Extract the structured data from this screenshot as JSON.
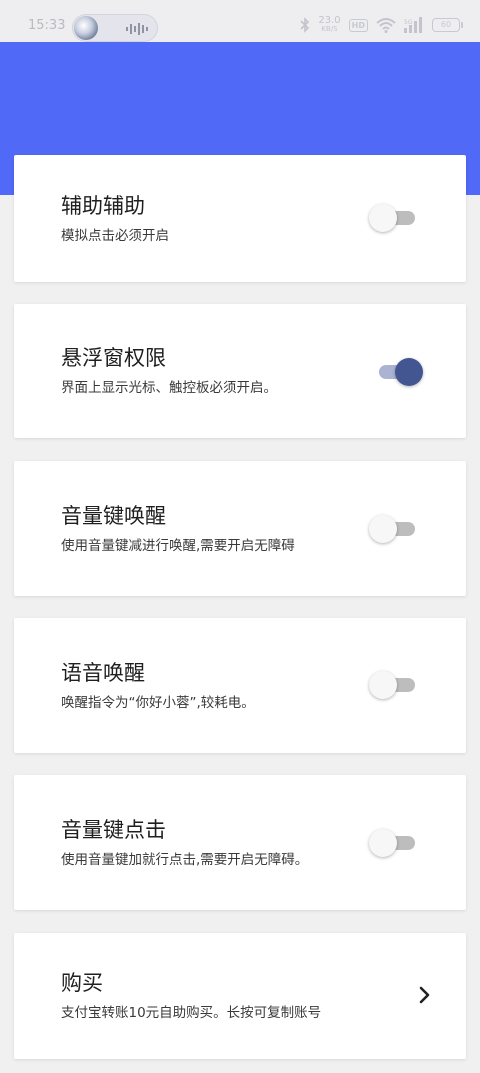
{
  "status_bar": {
    "time": "15:33",
    "net_speed": "23.0",
    "net_unit": "KB/S",
    "hd": "HD",
    "signal": "5G",
    "battery": "60"
  },
  "colors": {
    "header": "#5169f7",
    "toggle_on": "#435691",
    "toggle_off": "#bdbdbd"
  },
  "settings": [
    {
      "title": "辅助辅助",
      "desc": "模拟点击必须开启",
      "enabled": false
    },
    {
      "title": "悬浮窗权限",
      "desc": "界面上显示光标、触控板必须开启。",
      "enabled": true
    },
    {
      "title": "音量键唤醒",
      "desc": "使用音量键减进行唤醒,需要开启无障碍",
      "enabled": false
    },
    {
      "title": "语音唤醒",
      "desc": "唤醒指令为“你好小蓉”,较耗电。",
      "enabled": false
    },
    {
      "title": "音量键点击",
      "desc": "使用音量键加就行点击,需要开启无障碍。",
      "enabled": false
    }
  ],
  "purchase": {
    "title": "购买",
    "desc": "支付宝转账10元自助购买。长按可复制账号",
    "icon": "chevron-right-icon"
  }
}
